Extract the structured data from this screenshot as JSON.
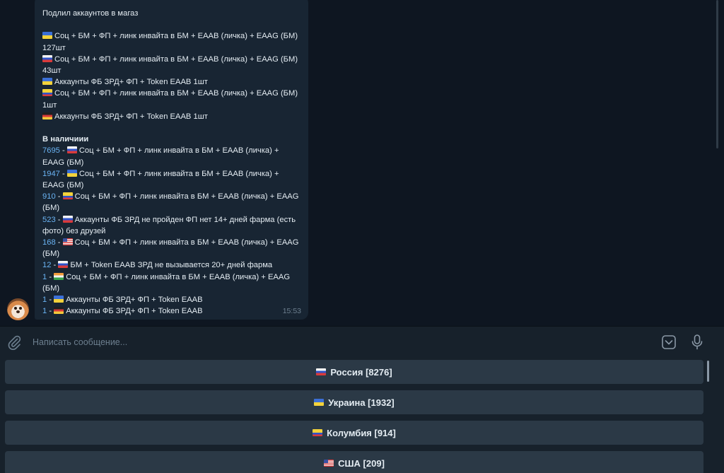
{
  "chat": {
    "message": {
      "lines": [
        "Подлил аккаунтов в магаз",
        "Соц + БМ + ФП + линк инвайта в БМ + ЕААВ (личка) + ЕААG (БМ) 127шт",
        "Соц + БМ + ФП + линк инвайта в БМ + ЕААВ (личка) + ЕААG (БМ) 43шт",
        "Аккаунты ФБ ЗРД+ ФП + Token EAAB 1шт",
        "Соц + БМ + ФП + линк инвайта в БМ + ЕААВ (личка) + ЕААG (БМ) 1шт",
        "Аккаунты ФБ ЗРД+ ФП + Token EAAB 1шт"
      ],
      "stock_heading": "В наличиии",
      "stock": [
        {
          "count": "7695",
          "sep": " - ",
          "text": "Соц + БМ + ФП + линк инвайта в БМ + ЕААВ (личка) + ЕААG (БМ)"
        },
        {
          "count": "1947",
          "sep": " - ",
          "text": "Соц + БМ + ФП + линк инвайта в БМ + ЕААВ (личка) + ЕААG (БМ)"
        },
        {
          "count": "910",
          "sep": " - ",
          "text": "Соц + БМ + ФП + линк инвайта в БМ + ЕААВ (личка) + ЕААG (БМ)"
        },
        {
          "count": "523",
          "sep": " - ",
          "text": "Аккаунты ФБ ЗРД не пройден ФП нет 14+ дней фарма (есть фото) без друзей"
        },
        {
          "count": "168",
          "sep": " - ",
          "text": "Соц + БМ + ФП + линк инвайта в БМ + ЕААВ (личка) + ЕААG (БМ)"
        },
        {
          "count": "12",
          "sep": " - ",
          "text": "БМ + Token EAAB ЗРД не вызывается 20+ дней фарма"
        },
        {
          "count": "1",
          "sep": " - ",
          "text": "Соц + БМ + ФП + линк инвайта в БМ + ЕААВ (личка) + ЕААG (БМ)"
        },
        {
          "count": "1",
          "sep": " - ",
          "text": "Аккаунты ФБ ЗРД+ ФП + Token EAAB"
        },
        {
          "count": "1",
          "sep": " - ",
          "text": "Аккаунты ФБ ЗРД+ ФП + Token EAAB"
        }
      ],
      "time": "15:53"
    }
  },
  "composer": {
    "placeholder": "Написать сообщение..."
  },
  "keyboard": {
    "buttons": [
      {
        "label": "Россия [8276]"
      },
      {
        "label": "Украина [1932]"
      },
      {
        "label": "Колумбия [914]"
      },
      {
        "label": "США [209]"
      }
    ]
  },
  "icons": {
    "attach": "paperclip-icon",
    "keyboard": "keyboard-toggle-icon",
    "voice": "microphone-icon"
  },
  "colors": {
    "background": "#0e1621",
    "bubble": "#182533",
    "panel": "#17212b",
    "button": "#2b3946",
    "accent": "#6ab3f3"
  }
}
